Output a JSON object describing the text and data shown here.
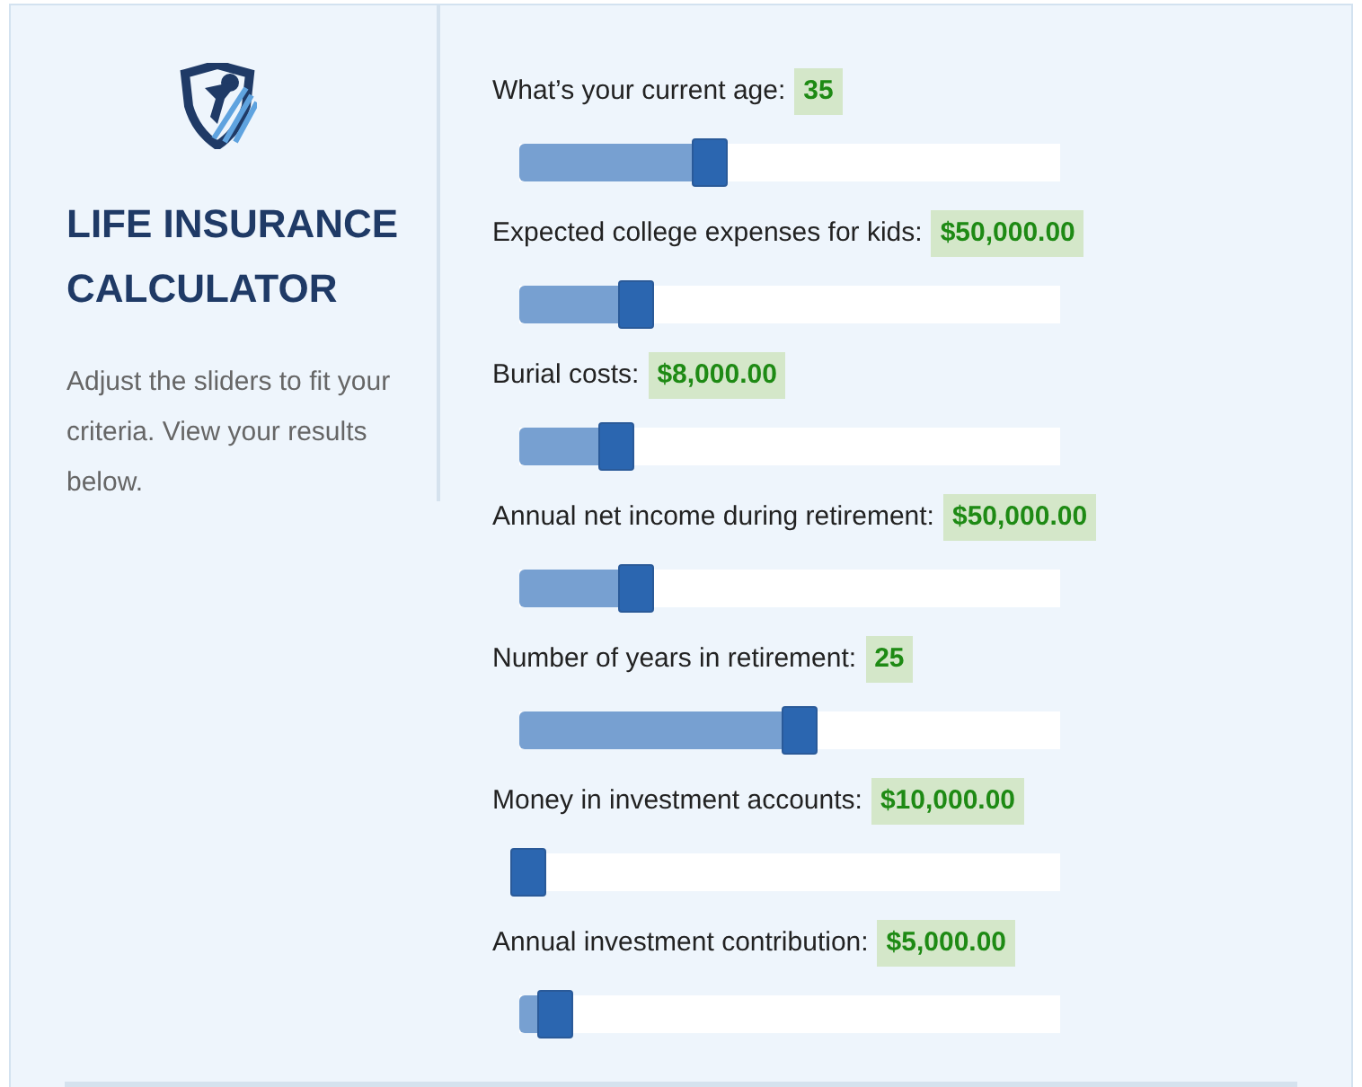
{
  "title": "LIFE INSURANCE CALCULATOR",
  "description": "Adjust the sliders to fit your criteria. View your results below.",
  "sliders": [
    {
      "label": "What’s your current age:",
      "value": "35",
      "level": 0.335
    },
    {
      "label": "Expected college expenses for kids:",
      "value": "$50,000.00",
      "level": 0.2
    },
    {
      "label": "Burial costs:",
      "value": "$8,000.00",
      "level": 0.163
    },
    {
      "label": "Annual net income during retirement:",
      "value": "$50,000.00",
      "level": 0.2
    },
    {
      "label": "Number of years in retirement:",
      "value": "25",
      "level": 0.5
    },
    {
      "label": "Money in investment accounts:",
      "value": "$10,000.00",
      "level": 0.0
    },
    {
      "label": "Annual investment contribution:",
      "value": "$5,000.00",
      "level": 0.05
    }
  ]
}
